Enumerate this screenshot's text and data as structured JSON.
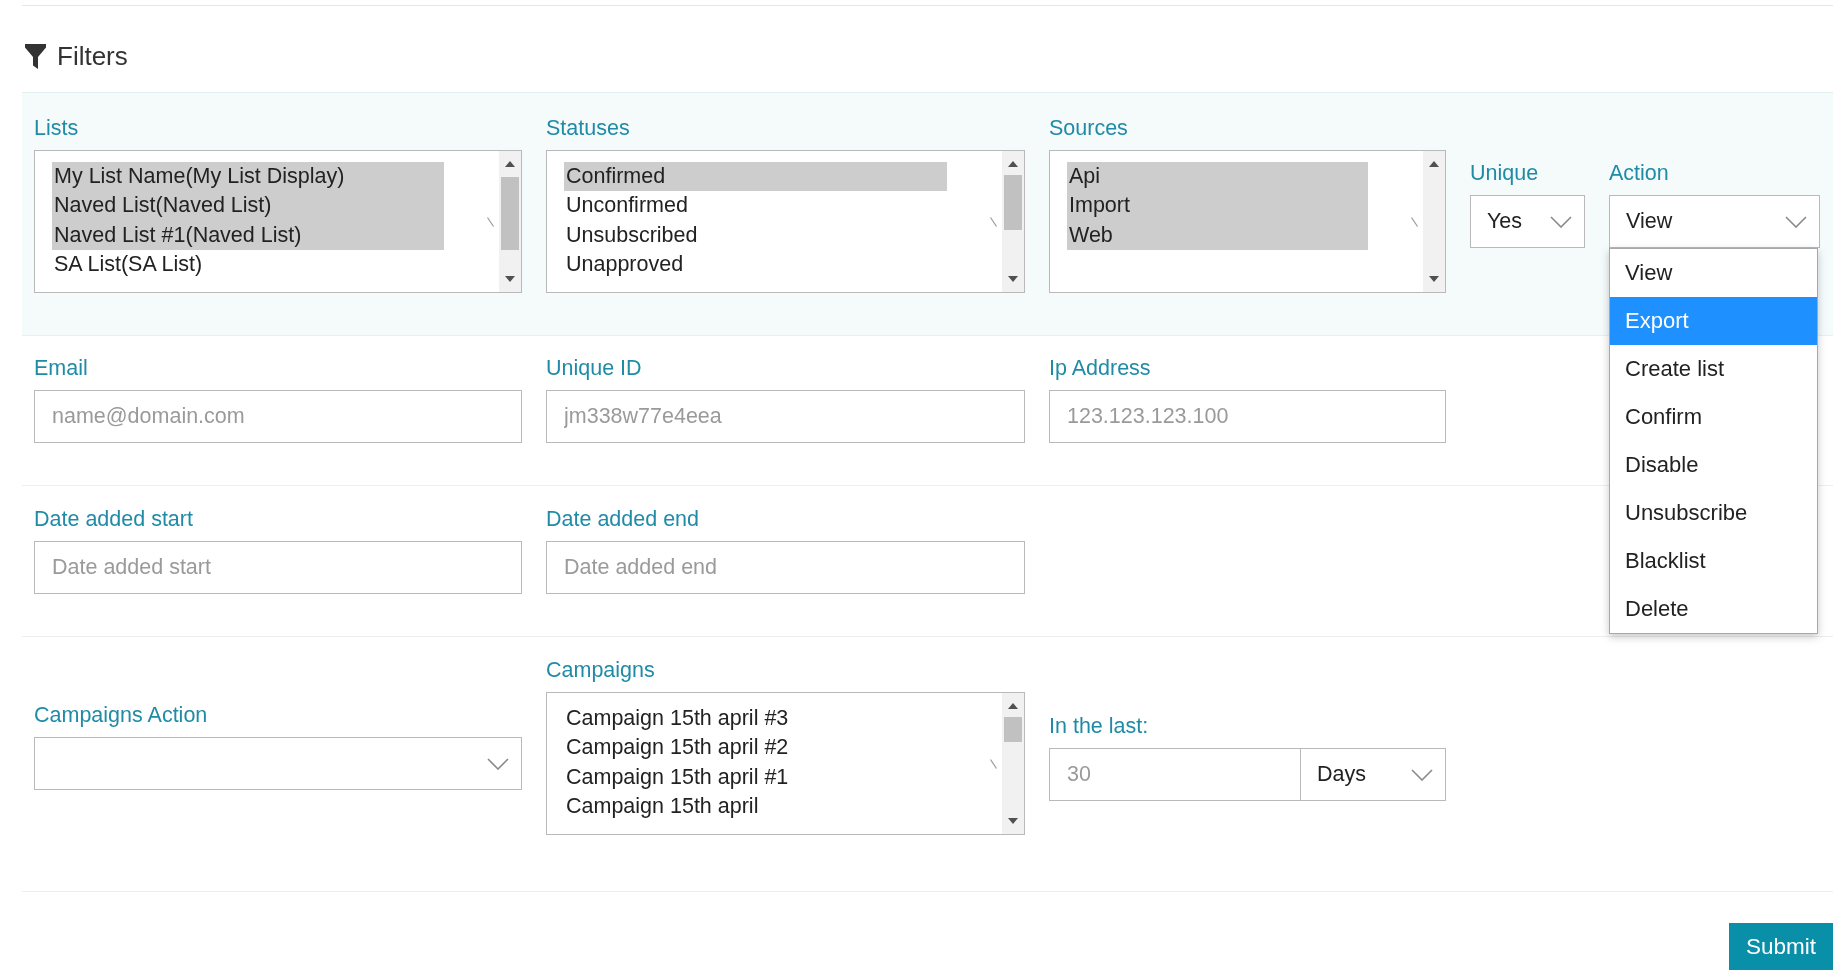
{
  "header": {
    "title": "Filters"
  },
  "rows": [
    {
      "fields": [
        {
          "kind": "listbox",
          "label": "Lists",
          "options": [
            {
              "text": "My List Name(My List Display)",
              "selected": true
            },
            {
              "text": "Naved List(Naved List)",
              "selected": true
            },
            {
              "text": "Naved List #1(Naved List)",
              "selected": true
            },
            {
              "text": "SA List(SA List)",
              "selected": false
            }
          ]
        },
        {
          "kind": "listbox",
          "label": "Statuses",
          "options": [
            {
              "text": "Confirmed",
              "selected": true
            },
            {
              "text": "Unconfirmed",
              "selected": false
            },
            {
              "text": "Unsubscribed",
              "selected": false
            },
            {
              "text": "Unapproved",
              "selected": false
            }
          ]
        },
        {
          "kind": "listbox",
          "label": "Sources",
          "options": [
            {
              "text": "Api",
              "selected": true
            },
            {
              "text": "Import",
              "selected": true
            },
            {
              "text": "Web",
              "selected": true
            }
          ]
        },
        {
          "kind": "select",
          "label": "Unique",
          "value": "Yes"
        },
        {
          "kind": "select",
          "label": "Action",
          "value": "View",
          "expanded": true,
          "menu": [
            {
              "text": "View",
              "highlighted": false
            },
            {
              "text": "Export",
              "highlighted": true
            },
            {
              "text": "Create list",
              "highlighted": false
            },
            {
              "text": "Confirm",
              "highlighted": false
            },
            {
              "text": "Disable",
              "highlighted": false
            },
            {
              "text": "Unsubscribe",
              "highlighted": false
            },
            {
              "text": "Blacklist",
              "highlighted": false
            },
            {
              "text": "Delete",
              "highlighted": false
            }
          ]
        }
      ]
    },
    {
      "fields": [
        {
          "kind": "input",
          "label": "Email",
          "placeholder": "name@domain.com"
        },
        {
          "kind": "input",
          "label": "Unique ID",
          "placeholder": "jm338w77e4eea"
        },
        {
          "kind": "input",
          "label": "Ip Address",
          "placeholder": "123.123.123.100"
        }
      ]
    },
    {
      "fields": [
        {
          "kind": "input",
          "label": "Date added start",
          "placeholder": "Date added start"
        },
        {
          "kind": "input",
          "label": "Date added end",
          "placeholder": "Date added end"
        }
      ]
    },
    {
      "fields": [
        {
          "kind": "select",
          "label": "Campaigns Action"
        },
        {
          "kind": "listbox",
          "label": "Campaigns",
          "options": [
            {
              "text": "Campaign 15th april #3",
              "selected": false
            },
            {
              "text": "Campaign 15th april #2",
              "selected": false
            },
            {
              "text": "Campaign 15th april #1",
              "selected": false
            },
            {
              "text": "Campaign 15th april",
              "selected": false
            }
          ]
        },
        {
          "kind": "input-group",
          "label": "In the last:",
          "placeholder": "30",
          "unit": "Days"
        }
      ]
    }
  ],
  "footer": {
    "submit": "Submit"
  }
}
